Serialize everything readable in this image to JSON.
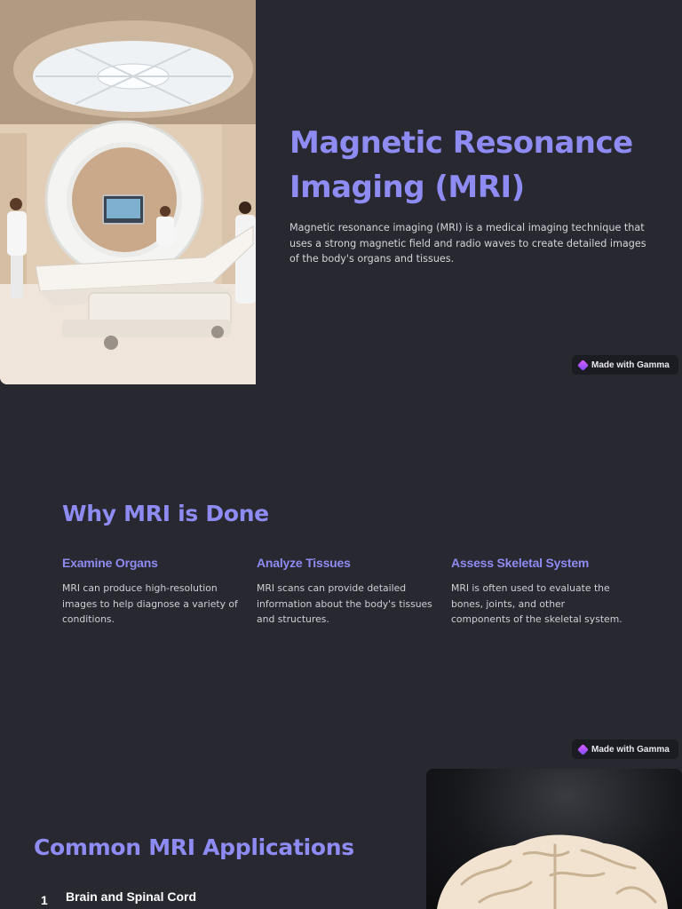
{
  "slide1": {
    "title": "Magnetic Resonance Imaging (MRI)",
    "lead": "Magnetic resonance imaging (MRI) is a medical imaging technique that uses a strong magnetic field and radio waves to create detailed images of the body's organs and tissues.",
    "image_icon": "mri-room-photo"
  },
  "badge": {
    "label": "Made with Gamma",
    "icon": "gamma-logo-icon"
  },
  "slide2": {
    "title": "Why MRI is Done",
    "columns": [
      {
        "heading": "Examine Organs",
        "text": "MRI can produce high-resolution images to help diagnose a variety of conditions."
      },
      {
        "heading": "Analyze Tissues",
        "text": "MRI scans can provide detailed information about the body's tissues and structures."
      },
      {
        "heading": "Assess Skeletal System",
        "text": "MRI is often used to evaluate the bones, joints, and other components of the skeletal system."
      }
    ]
  },
  "slide3": {
    "title": "Common MRI Applications",
    "items": [
      {
        "number": "1",
        "title": "Brain and Spinal Cord"
      }
    ],
    "image_icon": "brain-model-photo"
  },
  "colors": {
    "background": "#272830",
    "accent": "#8e8cf2",
    "text": "#d4d4da"
  }
}
